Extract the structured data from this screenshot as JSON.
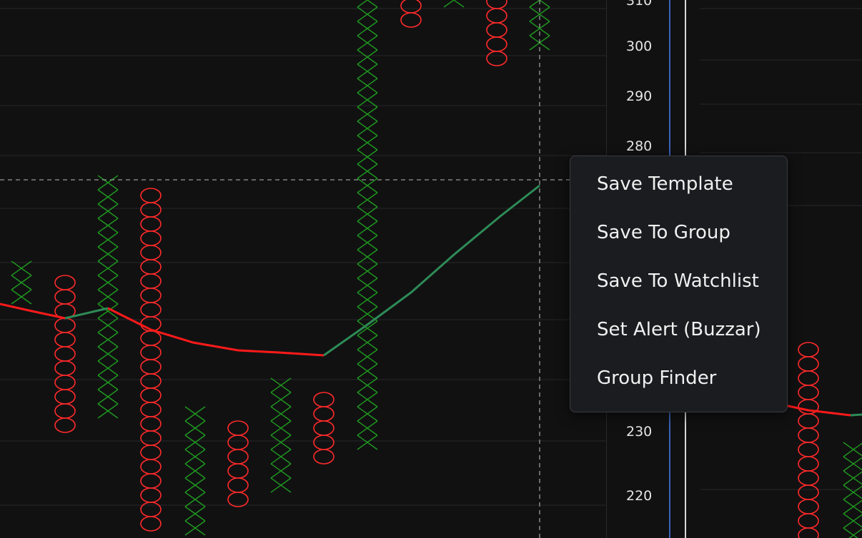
{
  "price_axis": {
    "ticks": [
      {
        "label": "310"
      },
      {
        "label": "300"
      },
      {
        "label": "290"
      },
      {
        "label": "280"
      },
      {
        "label": "230"
      },
      {
        "label": "220"
      }
    ]
  },
  "context_menu": {
    "items": [
      {
        "label": "Save Template"
      },
      {
        "label": "Save To Group"
      },
      {
        "label": "Save To Watchlist"
      },
      {
        "label": "Set Alert (Buzzar)"
      },
      {
        "label": "Group Finder"
      }
    ]
  },
  "colors": {
    "background": "#111112",
    "x_column": "#1f9a1f",
    "o_column": "#ff2a2a",
    "ma_down": "#ff1a1a",
    "ma_up": "#2e8b57",
    "crosshair": "#9a9a9a"
  },
  "icons": {
    "x_mark": "x-icon",
    "o_mark": "o-icon"
  }
}
